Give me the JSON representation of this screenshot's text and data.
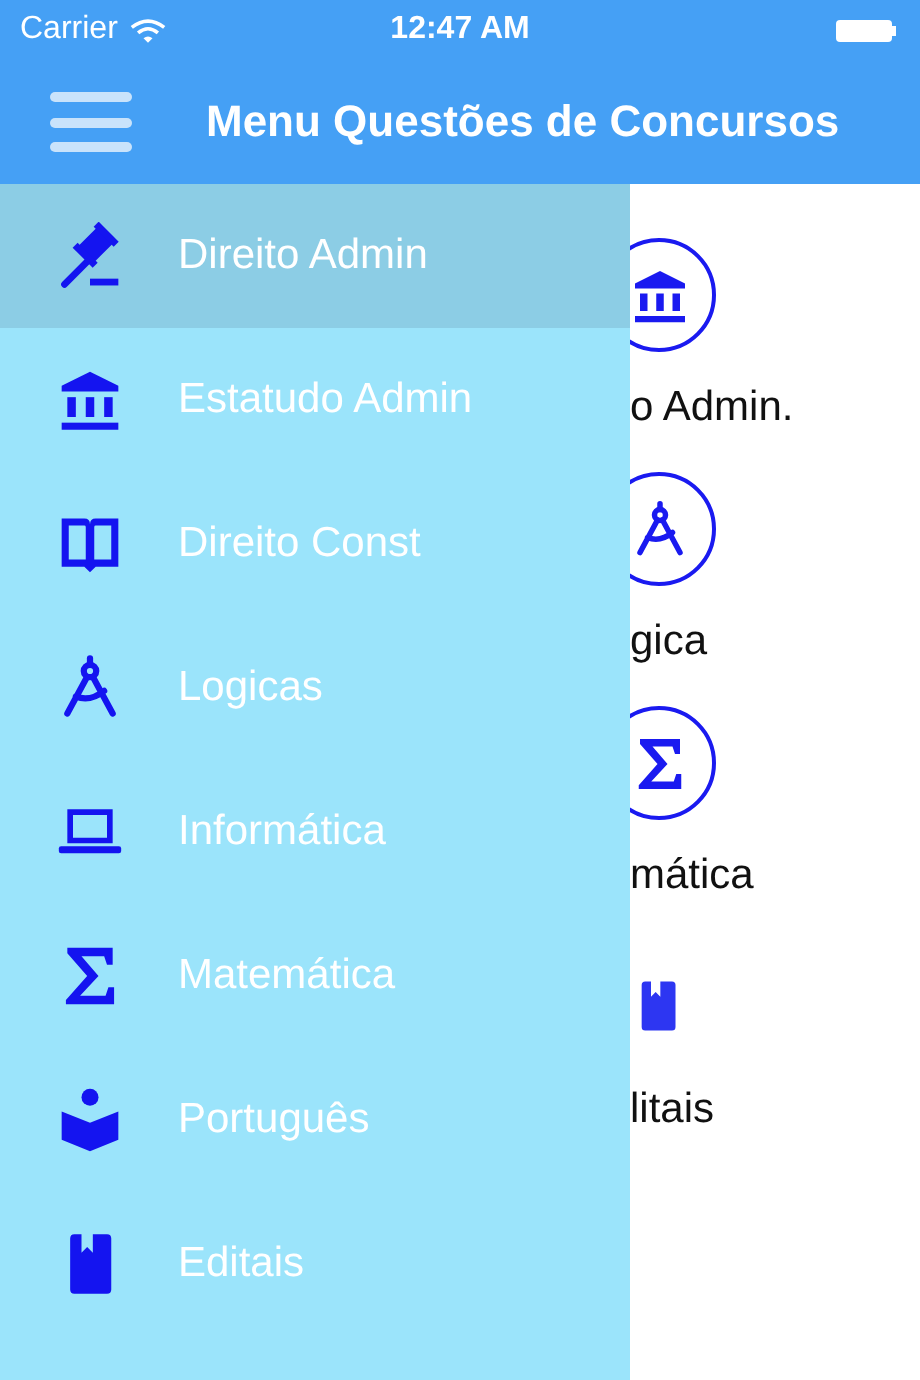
{
  "status_bar": {
    "carrier": "Carrier",
    "time": "12:47 AM"
  },
  "nav_bar": {
    "title": "Menu Questões de Concursos"
  },
  "content": {
    "tiles": [
      {
        "label": "o Admin.",
        "kind": "bank"
      },
      {
        "label": "gica",
        "kind": "compass"
      },
      {
        "label": "mática",
        "kind": "sigma"
      },
      {
        "label": "litais",
        "kind": "bookmark"
      }
    ]
  },
  "drawer": {
    "items": [
      {
        "label": "Direito Admin",
        "kind": "gavel",
        "selected": true
      },
      {
        "label": "Estatudo Admin",
        "kind": "bank",
        "selected": false
      },
      {
        "label": "Direito Const",
        "kind": "book",
        "selected": false
      },
      {
        "label": "Logicas",
        "kind": "compass",
        "selected": false
      },
      {
        "label": "Informática",
        "kind": "laptop",
        "selected": false
      },
      {
        "label": "Matemática",
        "kind": "sigma",
        "selected": false
      },
      {
        "label": "Português",
        "kind": "reader",
        "selected": false
      },
      {
        "label": "Editais",
        "kind": "bookmark",
        "selected": false
      }
    ]
  }
}
